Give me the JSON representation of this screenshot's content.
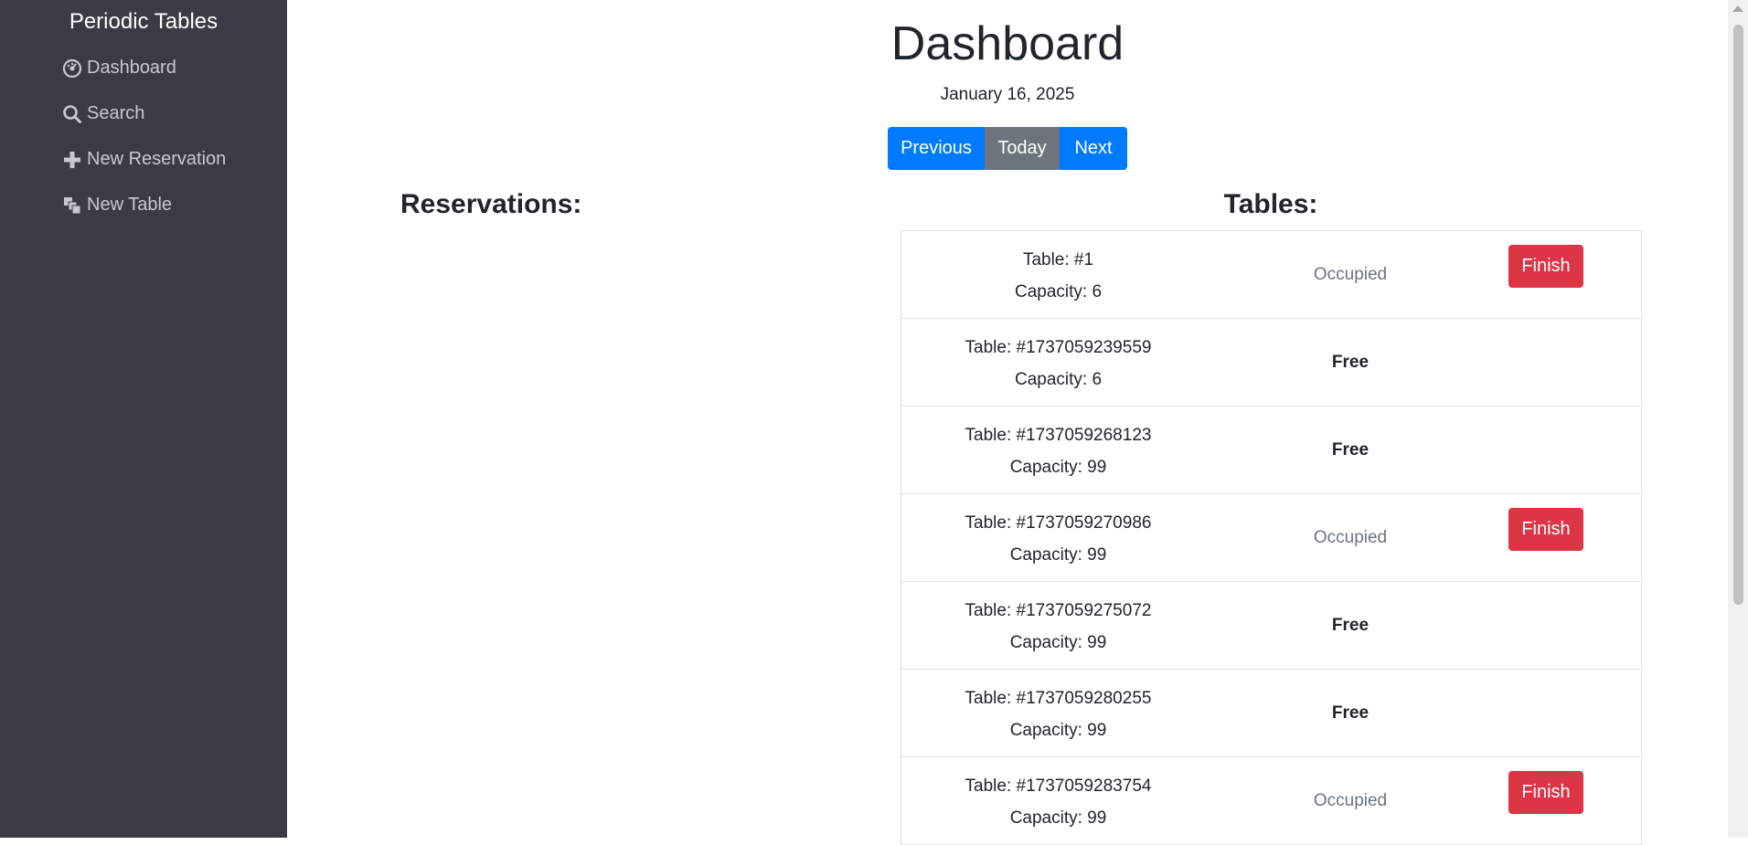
{
  "sidebar": {
    "brand": "Periodic Tables",
    "items": [
      {
        "label": "Dashboard",
        "icon": "dashboard-icon"
      },
      {
        "label": "Search",
        "icon": "search-icon"
      },
      {
        "label": "New Reservation",
        "icon": "plus-icon"
      },
      {
        "label": "New Table",
        "icon": "table-icon"
      }
    ]
  },
  "main": {
    "title": "Dashboard",
    "date": "January 16, 2025",
    "nav_buttons": {
      "previous": "Previous",
      "today": "Today",
      "next": "Next"
    },
    "reservations_heading": "Reservations:",
    "tables_heading": "Tables:"
  },
  "tables": [
    {
      "table_text": "Table: #1",
      "capacity_text": "Capacity: 6",
      "status": "Occupied",
      "finish_label": "Finish"
    },
    {
      "table_text": "Table: #1737059239559",
      "capacity_text": "Capacity: 6",
      "status": "Free"
    },
    {
      "table_text": "Table: #1737059268123",
      "capacity_text": "Capacity: 99",
      "status": "Free"
    },
    {
      "table_text": "Table: #1737059270986",
      "capacity_text": "Capacity: 99",
      "status": "Occupied",
      "finish_label": "Finish"
    },
    {
      "table_text": "Table: #1737059275072",
      "capacity_text": "Capacity: 99",
      "status": "Free"
    },
    {
      "table_text": "Table: #1737059280255",
      "capacity_text": "Capacity: 99",
      "status": "Free"
    },
    {
      "table_text": "Table: #1737059283754",
      "capacity_text": "Capacity: 99",
      "status": "Occupied",
      "finish_label": "Finish"
    }
  ],
  "colors": {
    "sidebar_bg": "#3a3b45",
    "primary": "#007bff",
    "secondary": "#6c757d",
    "danger": "#dc3545"
  }
}
